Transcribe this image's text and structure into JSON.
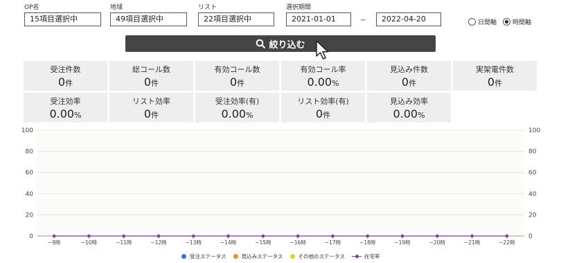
{
  "filters": {
    "op": {
      "label": "OP名",
      "value": "15項目選択中"
    },
    "area": {
      "label": "地域",
      "value": "49項目選択中"
    },
    "list": {
      "label": "リスト",
      "value": "22項目選択中"
    },
    "period": {
      "label": "選択期間",
      "start": "2021-01-01",
      "separator": "~",
      "end": "2022-04-20"
    }
  },
  "axis_toggle": {
    "options": [
      {
        "label": "日間軸",
        "selected": false
      },
      {
        "label": "時間軸",
        "selected": true
      }
    ]
  },
  "submit_button": {
    "label": "絞り込む",
    "icon": "search-icon"
  },
  "stats": [
    {
      "title": "受注件数",
      "value": "0",
      "unit": "件"
    },
    {
      "title": "総コール数",
      "value": "0",
      "unit": "件"
    },
    {
      "title": "有効コール数",
      "value": "0",
      "unit": "件"
    },
    {
      "title": "有効コール率",
      "value": "0.00",
      "unit": "%"
    },
    {
      "title": "見込み件数",
      "value": "0",
      "unit": "件"
    },
    {
      "title": "実架電件数",
      "value": "0",
      "unit": "件"
    },
    {
      "title": "受注効率",
      "value": "0.00",
      "unit": "%"
    },
    {
      "title": "リスト効率",
      "value": "0",
      "unit": "件"
    },
    {
      "title": "受注効率(有)",
      "value": "0.00",
      "unit": "%"
    },
    {
      "title": "リスト効率(有)",
      "value": "0",
      "unit": "件"
    },
    {
      "title": "見込み効率",
      "value": "0.00",
      "unit": "%"
    }
  ],
  "chart_data": {
    "type": "line",
    "categories": [
      "~9時",
      "~10時",
      "~11時",
      "~12時",
      "~13時",
      "~14時",
      "~15時",
      "~16時",
      "~17時",
      "~18時",
      "~19時",
      "~20時",
      "~21時",
      "~22時"
    ],
    "ylim": [
      0,
      100
    ],
    "yticks": [
      0,
      20,
      40,
      60,
      80,
      100
    ],
    "grid": true,
    "legend_position": "bottom",
    "series": [
      {
        "name": "受注ステータス",
        "color": "#3b6fd8",
        "values": [
          0,
          0,
          0,
          0,
          0,
          0,
          0,
          0,
          0,
          0,
          0,
          0,
          0,
          0
        ]
      },
      {
        "name": "見込みステータス",
        "color": "#e8962a",
        "values": [
          0,
          0,
          0,
          0,
          0,
          0,
          0,
          0,
          0,
          0,
          0,
          0,
          0,
          0
        ]
      },
      {
        "name": "その他のステータス",
        "color": "#e6d02a",
        "values": [
          0,
          0,
          0,
          0,
          0,
          0,
          0,
          0,
          0,
          0,
          0,
          0,
          0,
          0
        ]
      },
      {
        "name": "在宅率",
        "color": "#7b3fa0",
        "values": [
          0,
          0,
          0,
          0,
          0,
          0,
          0,
          0,
          0,
          0,
          0,
          0,
          0,
          0
        ]
      }
    ]
  }
}
